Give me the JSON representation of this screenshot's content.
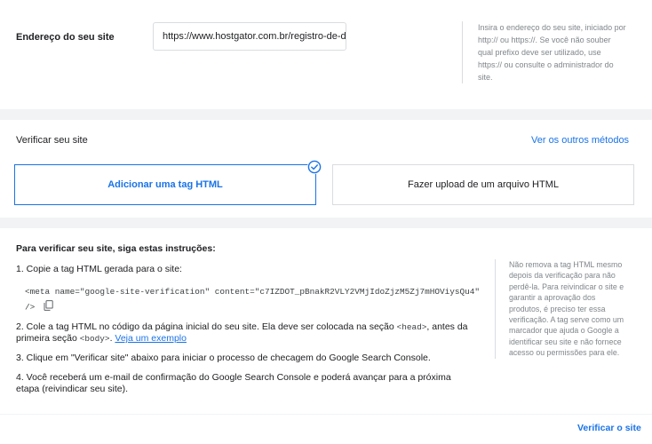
{
  "site_address": {
    "label": "Endereço do seu site",
    "value": "https://www.hostgator.com.br/registro-de-don",
    "help": "Insira o endereço do seu site, iniciado por http:// ou https://. Se você não souber qual prefixo deve ser utilizado, use https:// ou consulte o administrador do site."
  },
  "verify": {
    "title": "Verificar seu site",
    "other_methods": "Ver os outros métodos",
    "methods": [
      {
        "label": "Adicionar uma tag HTML",
        "selected": true
      },
      {
        "label": "Fazer upload de um arquivo HTML",
        "selected": false
      }
    ]
  },
  "instructions": {
    "title": "Para verificar seu site, siga estas instruções:",
    "step1": "1. Copie a tag HTML gerada para o site:",
    "meta_line1": "<meta name=\"google-site-verification\" content=\"c7IZDOT_pBnakR2VLY2VMjIdoZjzM5Zj7mHOViysQu4\"",
    "meta_line2": "/>",
    "step2_pre": "2. Cole a tag HTML no código da página inicial do seu site. Ela deve ser colocada na seção",
    "head_tag": "<head>",
    "step2_mid": ", antes da primeira seção",
    "body_tag": "<body>",
    "step2_link": "Veja um exemplo",
    "step3": "3. Clique em \"Verificar site\" abaixo para iniciar o processo de checagem do Google Search Console.",
    "step4": "4. Você receberá um e-mail de confirmação do Google Search Console e poderá avançar para a próxima etapa (reivindicar seu site).",
    "side_note": "Não remova a tag HTML mesmo depois da verificação para não perdê-la. Para reivindicar o site e garantir a aprovação dos produtos, é preciso ter essa verificação. A tag serve como um marcador que ajuda o Google a identificar seu site e não fornece acesso ou permissões para ele."
  },
  "footer": {
    "verify_button": "Verificar o site"
  },
  "colors": {
    "accent": "#1a73e8",
    "background": "#f1f3f4",
    "border": "#dadce0"
  }
}
